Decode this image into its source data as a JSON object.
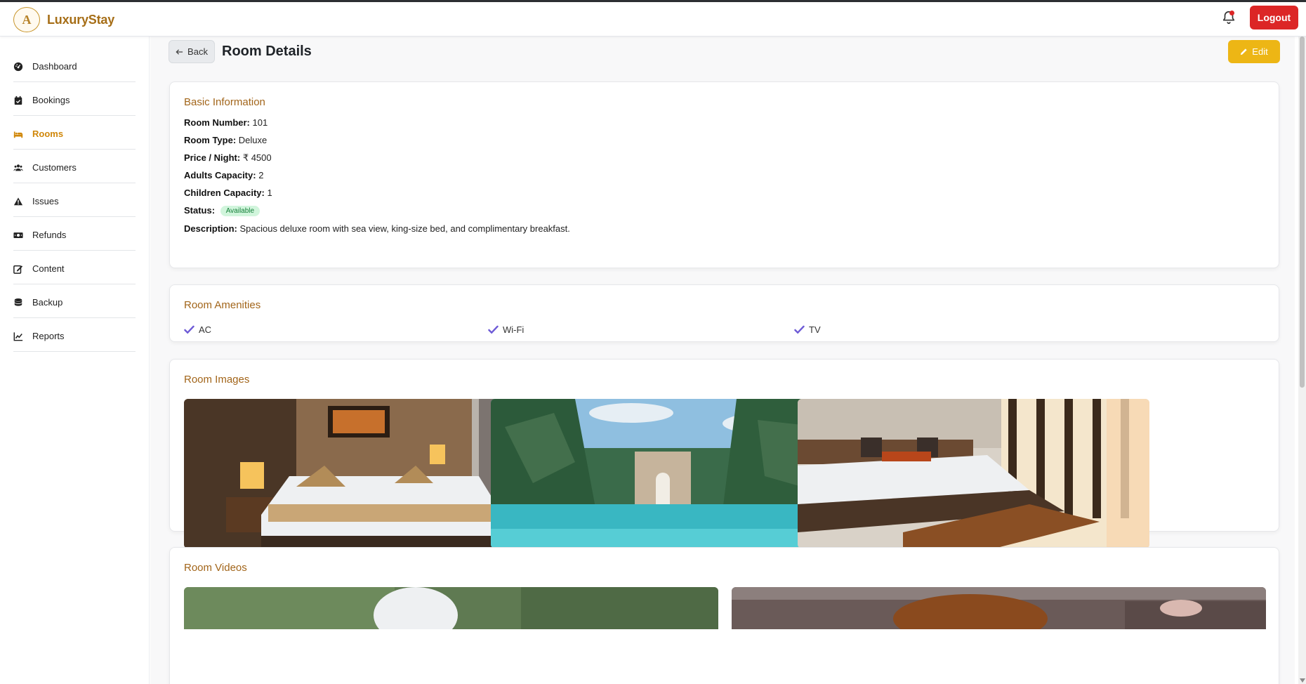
{
  "app": {
    "brand_name": "LuxuryStay",
    "logo_letter": "A",
    "logout_label": "Logout",
    "accent_color": "#a2651a",
    "logout_color": "#dc2626",
    "edit_color": "#edb615"
  },
  "sidebar": {
    "items": [
      {
        "label": "Dashboard",
        "icon": "dashboard-gauge-icon",
        "active": false
      },
      {
        "label": "Bookings",
        "icon": "calendar-check-icon",
        "active": false
      },
      {
        "label": "Rooms",
        "icon": "bed-icon",
        "active": true
      },
      {
        "label": "Customers",
        "icon": "users-icon",
        "active": false
      },
      {
        "label": "Issues",
        "icon": "warning-triangle-icon",
        "active": false
      },
      {
        "label": "Refunds",
        "icon": "money-bill-icon",
        "active": false
      },
      {
        "label": "Content",
        "icon": "edit-square-icon",
        "active": false
      },
      {
        "label": "Backup",
        "icon": "database-icon",
        "active": false
      },
      {
        "label": "Reports",
        "icon": "line-chart-icon",
        "active": false
      }
    ]
  },
  "header": {
    "back_label": "Back",
    "title": "Room Details",
    "edit_label": "Edit"
  },
  "basic_info": {
    "title": "Basic Information",
    "rows": [
      {
        "label": "Room Number:",
        "value": "101"
      },
      {
        "label": "Room Type:",
        "value": "Deluxe"
      },
      {
        "label": "Price / Night:",
        "value": "₹ 4500"
      },
      {
        "label": "Adults Capacity:",
        "value": "2"
      },
      {
        "label": "Children Capacity:",
        "value": "1"
      }
    ],
    "status_label": "Status:",
    "status_value": "Available",
    "description_label": "Description:",
    "description_value": "Spacious deluxe room with sea view, king-size bed, and complimentary breakfast."
  },
  "amenities": {
    "title": "Room Amenities",
    "items": [
      "AC",
      "Wi-Fi",
      "TV"
    ]
  },
  "images": {
    "title": "Room Images",
    "items": [
      "hotel-bedroom-photo",
      "palm-pool-photo",
      "sunlit-bedroom-photo"
    ]
  },
  "videos": {
    "title": "Room Videos",
    "items": [
      "video-thumbnail-1",
      "video-thumbnail-2"
    ]
  }
}
